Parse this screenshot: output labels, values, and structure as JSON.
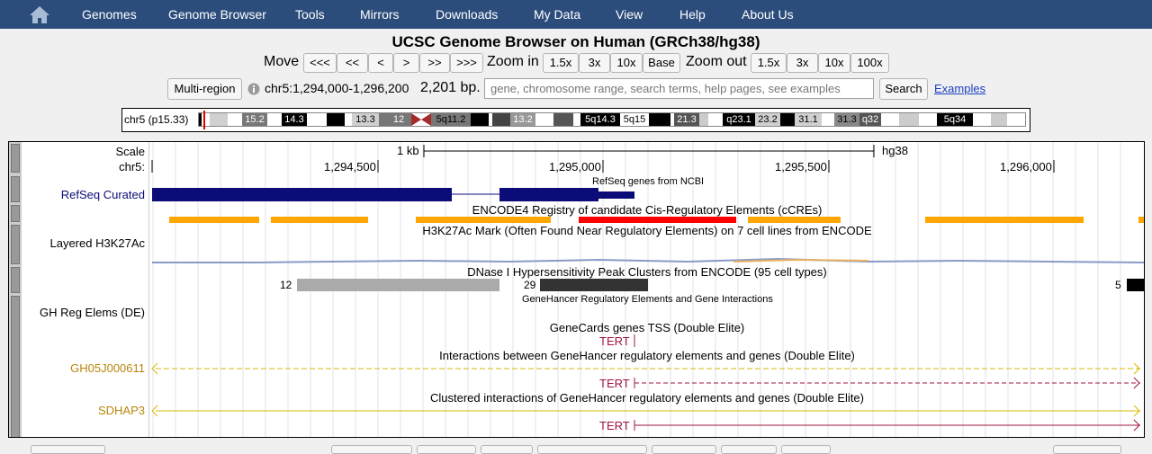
{
  "nav": {
    "items": [
      "Genomes",
      "Genome Browser",
      "Tools",
      "Mirrors",
      "Downloads",
      "My Data",
      "View",
      "Help",
      "About Us"
    ]
  },
  "title": "UCSC Genome Browser on Human (GRCh38/hg38)",
  "controls": {
    "move_label": "Move",
    "move_buttons": [
      "<<<",
      "<<",
      "<",
      ">",
      ">>",
      ">>>"
    ],
    "zoom_in_label": "Zoom in",
    "zoom_in_buttons": [
      "1.5x",
      "3x",
      "10x",
      "Base"
    ],
    "zoom_out_label": "Zoom out",
    "zoom_out_buttons": [
      "1.5x",
      "3x",
      "10x",
      "100x"
    ],
    "multi_region": "Multi-region",
    "position": "chr5:1,294,000-1,296,200",
    "size": "2,201 bp.",
    "search_placeholder": "gene, chromosome range, search terms, help pages, see examples",
    "search_button": "Search",
    "examples_link": "Examples"
  },
  "ideogram": {
    "label": "chr5 (p15.33)",
    "bands": [
      "15.2",
      "14.3",
      "13.3",
      "12",
      "5q11.2",
      "13.2",
      "5q14.3",
      "5q15",
      "21.3",
      "q23.1",
      "23.2",
      "31.1",
      "31.3",
      "q32",
      "5q34"
    ]
  },
  "tracks": {
    "scale_label": "Scale",
    "chr_label": "chr5:",
    "scale_text": "1 kb",
    "assembly": "hg38",
    "ruler_ticks": [
      "1,294,500",
      "1,295,000",
      "1,295,500",
      "1,296,000"
    ],
    "refseq_title": "RefSeq genes from NCBI",
    "refseq_label": "RefSeq Curated",
    "encode_title": "ENCODE4 Registry of candidate Cis-Regulatory Elements (cCREs)",
    "h3k27ac_title": "H3K27Ac Mark (Often Found Near Regulatory Elements) on 7 cell lines from ENCODE",
    "h3k27ac_label": "Layered H3K27Ac",
    "dnase_title": "DNase I Hypersensitivity Peak Clusters from ENCODE (95 cell types)",
    "dnase_scores": [
      "12",
      "29",
      "5"
    ],
    "gh_title": "GeneHancer Regulatory Elements and Gene Interactions",
    "gh_label": "GH Reg Elems (DE)",
    "tss_title": "GeneCards genes TSS (Double Elite)",
    "tss_gene": "TERT",
    "interactions_title": "Interactions between GeneHancer regulatory elements and genes (Double Elite)",
    "interactions_label": "GH05J000611",
    "interactions_gene": "TERT",
    "clustered_title": "Clustered interactions of GeneHancer regulatory elements and genes (Double Elite)",
    "clustered_label": "SDHAP3",
    "clustered_gene": "TERT"
  },
  "colors": {
    "nav_bg": "#2c4d7c",
    "refseq": "#0c0c78",
    "ccre_orange": "#ffa700",
    "ccre_red": "#ff0000",
    "gh_gold": "#b8860b",
    "tert_red": "#a0153e"
  }
}
